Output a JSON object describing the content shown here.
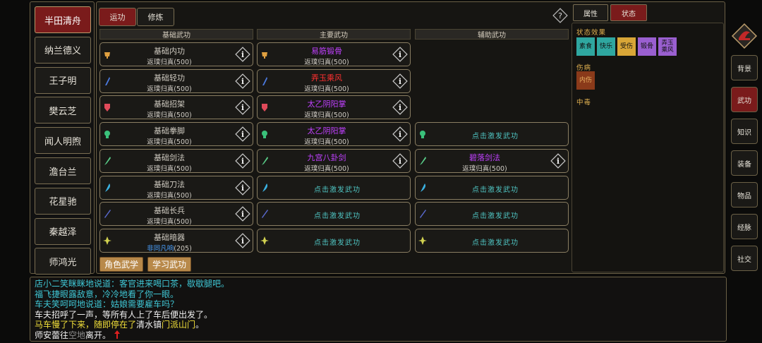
{
  "characters": [
    "半田清舟",
    "纳兰德义",
    "王子明",
    "樊云芝",
    "闻人明煦",
    "澹台兰",
    "花星驰",
    "秦越泽",
    "师鸿光"
  ],
  "top_tabs": [
    "运功",
    "修炼"
  ],
  "help_icon": "question-icon",
  "columns": [
    "基础武功",
    "主要武功",
    "辅助武功"
  ],
  "slots": {
    "basic": [
      {
        "name": "基础内功",
        "sub": "返璞归真(500)"
      },
      {
        "name": "基础轻功",
        "sub": "返璞归真(500)"
      },
      {
        "name": "基础招架",
        "sub": "返璞归真(500)"
      },
      {
        "name": "基础拳脚",
        "sub": "返璞归真(500)"
      },
      {
        "name": "基础剑法",
        "sub": "返璞归真(500)"
      },
      {
        "name": "基础刀法",
        "sub": "返璞归真(500)"
      },
      {
        "name": "基础长兵",
        "sub": "返璞归真(500)"
      },
      {
        "name": "基础暗器",
        "sub": "非同凡响(205)"
      }
    ],
    "main": [
      {
        "name": "易筋锻骨",
        "sub": "返璞归真(500)",
        "color": "#c040ff"
      },
      {
        "name": "弄玉乘风",
        "sub": "返璞归真(500)",
        "color": "#ff3030"
      },
      {
        "name": "太乙阴阳掌",
        "sub": "返璞归真(500)",
        "color": "#c040ff"
      },
      {
        "name": "太乙阴阳掌",
        "sub": "返璞归真(500)",
        "color": "#c040ff"
      },
      {
        "name": "九宫八卦剑",
        "sub": "返璞归真(500)",
        "color": "#c040ff"
      },
      {
        "name": "点击激发武功"
      },
      {
        "name": "点击激发武功"
      },
      {
        "name": "点击激发武功"
      }
    ],
    "aux": [
      {
        "name": "点击激发武功"
      },
      {
        "name": "碧落剑法",
        "sub": "返璞归真(500)",
        "color": "#c040ff"
      },
      {
        "name": "点击激发武功"
      },
      {
        "name": "点击激发武功"
      },
      {
        "name": "点击激发武功"
      }
    ]
  },
  "slot_icons": [
    "cup-icon",
    "feather-icon",
    "shield-icon",
    "fist-icon",
    "sword-icon",
    "blade-icon",
    "spear-icon",
    "dart-icon"
  ],
  "actions": [
    "角色武学",
    "学习武功"
  ],
  "right_tabs": [
    "属性",
    "状态"
  ],
  "status": {
    "effects_label": "状态效果",
    "effects": [
      {
        "text": "素食",
        "color": "#2fa7a0"
      },
      {
        "text": "快乐",
        "color": "#2fa7a0"
      },
      {
        "text": "受伤",
        "color": "#d9a637"
      },
      {
        "text": "锻骨",
        "color": "#9a5fd0"
      },
      {
        "text": "弄玉乘风",
        "color": "#9a5fd0"
      }
    ],
    "injury_label": "伤病",
    "injuries": [
      {
        "text": "内伤",
        "color": "#8a3a1a"
      }
    ],
    "poison_label": "中毒"
  },
  "nav": [
    "背景",
    "武功",
    "知识",
    "装备",
    "物品",
    "经脉",
    "社交"
  ],
  "nav_active": 1,
  "log": [
    {
      "parts": [
        {
          "t": "店小二笑眯眯地说道：客官进来喝口茶，歇歇腿吧。",
          "c": "c-cyan"
        }
      ]
    },
    {
      "parts": [
        {
          "t": "福飞捷眼露敌意，冷冷地看了你一眼。",
          "c": "c-cyan"
        }
      ]
    },
    {
      "parts": [
        {
          "t": "车夫笑呵呵地说道：姑娘需要雇车吗？",
          "c": "c-cyan"
        }
      ]
    },
    {
      "parts": [
        {
          "t": "车夫招呼了一声，等所有人上了车后便出发了。",
          "c": "c-white"
        }
      ]
    },
    {
      "parts": [
        {
          "t": "马车慢了下来，随即停在了",
          "c": "c-yellow"
        },
        {
          "t": "清水镇",
          "c": "c-white"
        },
        {
          "t": "门派山门",
          "c": "c-yellow"
        },
        {
          "t": "。",
          "c": "c-white"
        }
      ]
    },
    {
      "parts": [
        {
          "t": "师安蕾往",
          "c": "c-white"
        },
        {
          "t": "空地",
          "c": "c-gray"
        },
        {
          "t": "离开。",
          "c": "c-white"
        }
      ]
    }
  ]
}
